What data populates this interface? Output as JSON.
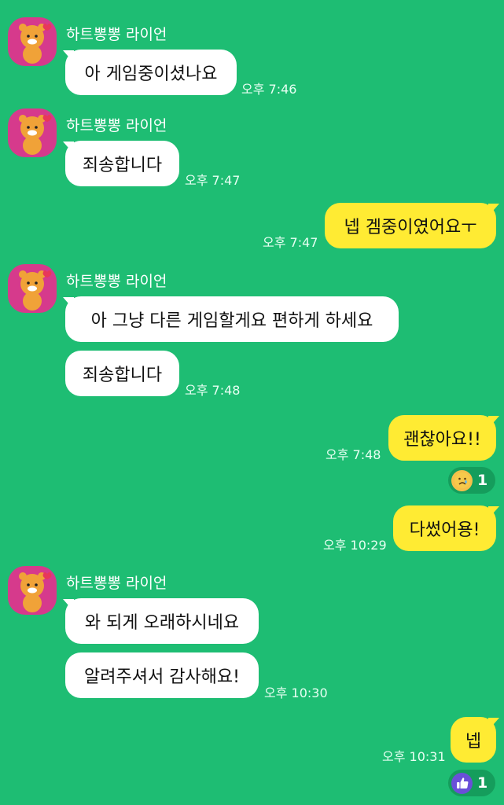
{
  "sender": {
    "name": "하트뽕뽕 라이언",
    "avatar_icon": "ryan-lion-avatar-icon"
  },
  "colors": {
    "background": "#1ebd73",
    "bubble_in": "#ffffff",
    "bubble_out": "#ffeb33",
    "avatar_bg": "#d63a8c"
  },
  "messages": [
    {
      "text": "아 게임중이셨나요",
      "time": "오후 7:46"
    },
    {
      "text": "죄송합니다",
      "time": "오후 7:47"
    },
    {
      "text": "넵 겜중이였어요ㅜ",
      "time": "오후 7:47"
    },
    {
      "text": "아 그냥 다른 게임할게요 편하게 하세요"
    },
    {
      "text": "죄송합니다",
      "time": "오후 7:48"
    },
    {
      "text": "괜찮아요!!",
      "time": "오후 7:48",
      "reaction": {
        "icon": "sad-face-icon",
        "count": "1"
      }
    },
    {
      "text": "다썼어용!",
      "time": "오후 10:29"
    },
    {
      "text": "와 되게 오래하시네요"
    },
    {
      "text": "알려주셔서 감사해요!",
      "time": "오후 10:30"
    },
    {
      "text": "넵",
      "time": "오후 10:31",
      "reaction": {
        "icon": "thumbs-up-icon",
        "count": "1"
      }
    }
  ]
}
